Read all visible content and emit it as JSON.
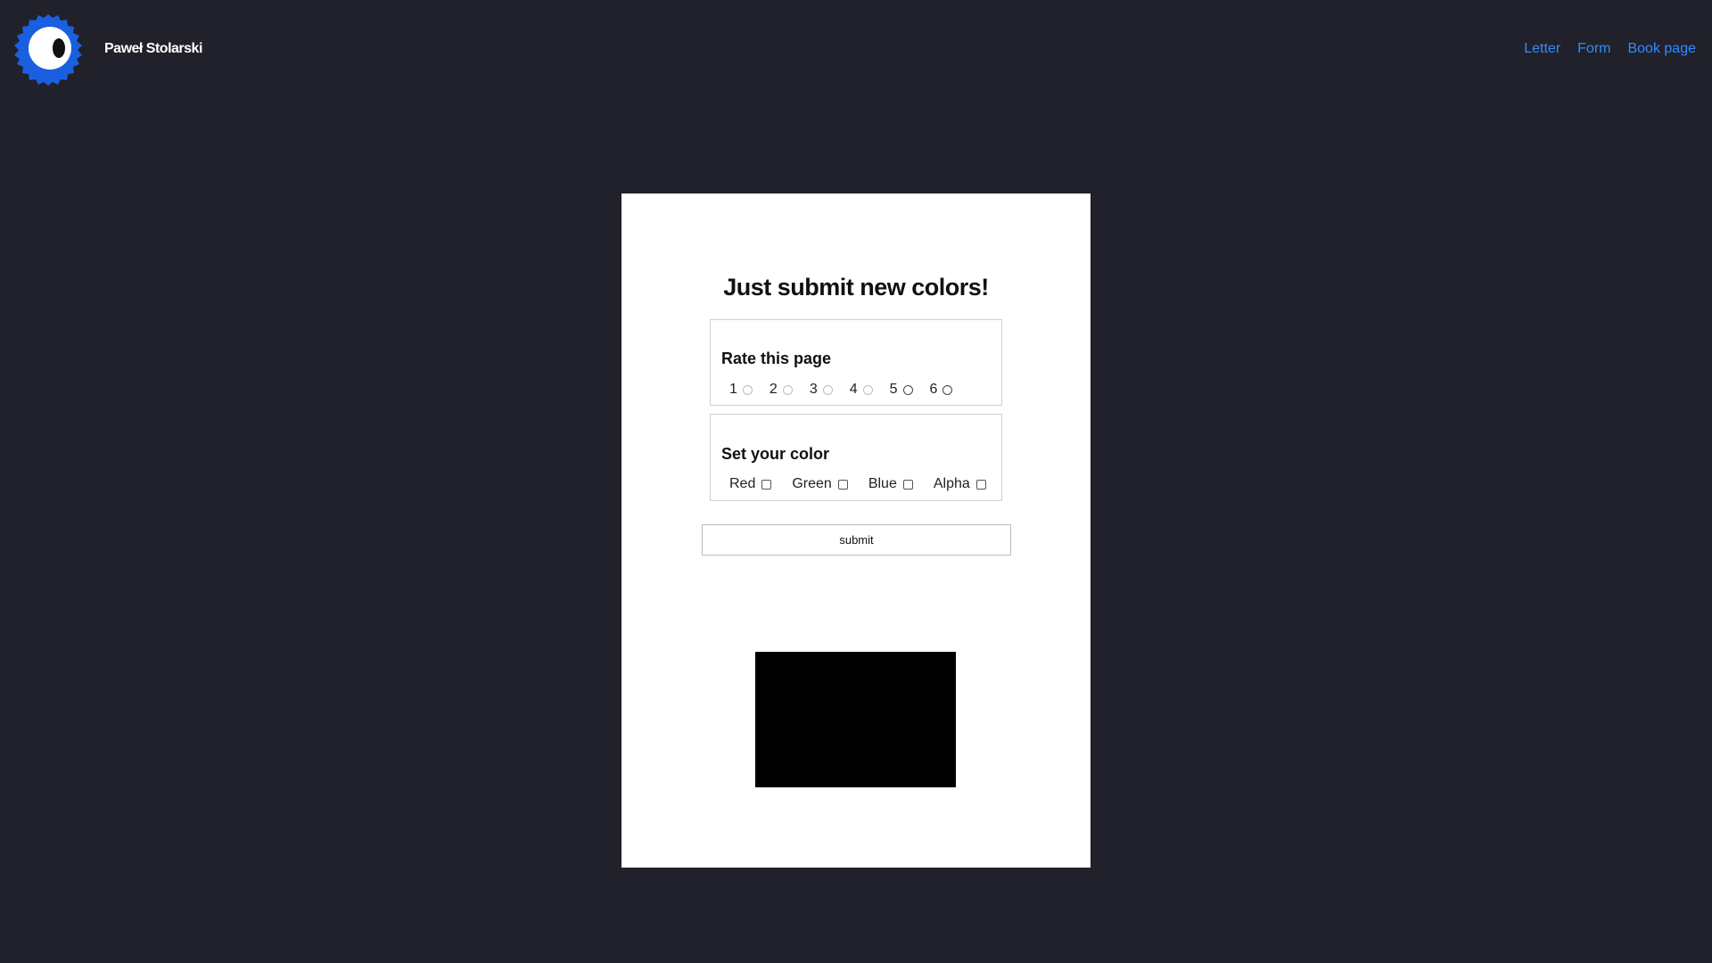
{
  "header": {
    "brand_name": "Paweł Stolarski",
    "nav": [
      {
        "label": "Letter"
      },
      {
        "label": "Form"
      },
      {
        "label": "Book page"
      }
    ],
    "logo": {
      "icon": "eye-icon",
      "color": "#1a5fe0"
    }
  },
  "form": {
    "title": "Just submit new colors!",
    "rate": {
      "legend": "Rate this page",
      "options": [
        "1",
        "2",
        "3",
        "4",
        "5",
        "6"
      ]
    },
    "color": {
      "legend": "Set your color",
      "options": [
        "Red",
        "Green",
        "Blue",
        "Alpha"
      ]
    },
    "submit_label": "submit",
    "preview_color": "#000000"
  },
  "colors": {
    "background": "#21212b",
    "card": "#ffffff",
    "link": "#2d8cff"
  }
}
